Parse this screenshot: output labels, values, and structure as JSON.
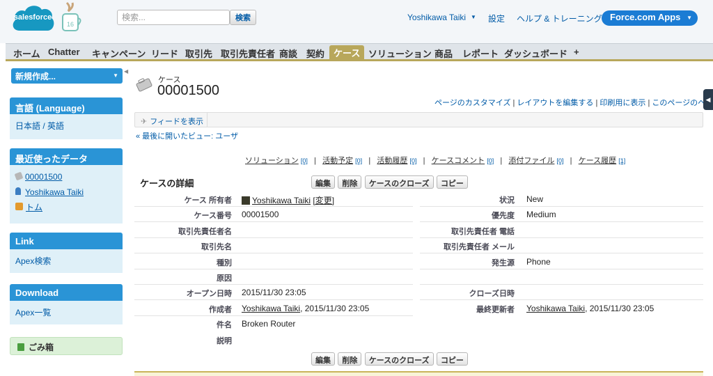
{
  "header": {
    "logo_text": "salesforce",
    "mascot_badge": "16",
    "search_placeholder": "検索...",
    "search_button": "検索",
    "user_name": "Yoshikawa Taiki",
    "setup_link": "設定",
    "help_link": "ヘルプ & トレーニング",
    "app_menu": "Force.com Apps"
  },
  "tabs": [
    {
      "label": "ホーム",
      "active": false
    },
    {
      "label": "Chatter",
      "active": false
    },
    {
      "label": "キャンペーン",
      "active": false
    },
    {
      "label": "リード",
      "active": false
    },
    {
      "label": "取引先",
      "active": false
    },
    {
      "label": "取引先責任者",
      "active": false
    },
    {
      "label": "商談",
      "active": false
    },
    {
      "label": "契約",
      "active": false
    },
    {
      "label": "ケース",
      "active": true
    },
    {
      "label": "ソリューション",
      "active": false
    },
    {
      "label": "商品",
      "active": false
    },
    {
      "label": "レポート",
      "active": false
    },
    {
      "label": "ダッシュボード",
      "active": false
    },
    {
      "label": "+",
      "active": false
    }
  ],
  "sidebar": {
    "new_select": "新規作成...",
    "language": {
      "title": "言語 (Language)",
      "item": "日本語 / 英語"
    },
    "recent": {
      "title": "最近使ったデータ",
      "items": [
        {
          "label": "00001500",
          "icon": "case-icon"
        },
        {
          "label": "Yoshikawa Taiki",
          "icon": "user-icon"
        },
        {
          "label": "トム",
          "icon": "contact-icon"
        }
      ]
    },
    "link": {
      "title": "Link",
      "item": "Apex検索"
    },
    "download": {
      "title": "Download",
      "item": "Apex一覧"
    },
    "trash": "ごみ箱"
  },
  "case": {
    "type_label": "ケース",
    "number": "00001500"
  },
  "page_links": {
    "customize": "ページのカスタマイズ",
    "edit_layout": "レイアウトを編集する",
    "printable": "印刷用に表示",
    "help": "このページのヘルプ"
  },
  "feed_button": "フィードを表示",
  "back_link": "« 最後に開いたビュー: ユーザ",
  "related_links": [
    {
      "label": "ソリューション",
      "count": "[0]"
    },
    {
      "label": "活動予定",
      "count": "[0]"
    },
    {
      "label": "活動履歴",
      "count": "[0]"
    },
    {
      "label": "ケースコメント",
      "count": "[0]"
    },
    {
      "label": "添付ファイル",
      "count": "[0]"
    },
    {
      "label": "ケース履歴",
      "count": "[1]"
    }
  ],
  "detail": {
    "title": "ケースの詳細",
    "buttons": {
      "edit": "編集",
      "delete": "削除",
      "close": "ケースのクローズ",
      "copy": "コピー"
    },
    "owner_label": "ケース 所有者",
    "owner_value": "Yoshikawa Taiki",
    "owner_change": "[変更]",
    "status_label": "状況",
    "status_value": "New",
    "number_label": "ケース番号",
    "number_value": "00001500",
    "priority_label": "優先度",
    "priority_value": "Medium",
    "contact_label": "取引先責任者名",
    "contact_phone_label": "取引先責任者 電話",
    "account_label": "取引先名",
    "contact_email_label": "取引先責任者 メール",
    "type_label": "種別",
    "origin_label": "発生源",
    "origin_value": "Phone",
    "reason_label": "原因",
    "opened_label": "オープン日時",
    "opened_value": "2015/11/30 23:05",
    "closed_label": "クローズ日時",
    "created_by_label": "作成者",
    "created_by_user": "Yoshikawa Taiki",
    "created_by_date": ", 2015/11/30 23:05",
    "modified_by_label": "最終更新者",
    "modified_by_user": "Yoshikawa Taiki",
    "modified_by_date": ", 2015/11/30 23:05",
    "subject_label": "件名",
    "subject_value": "Broken Router",
    "description_label": "説明"
  },
  "colors": {
    "sidebar_header": "#2a94d6",
    "sidebar_body": "#dff0f8",
    "active_tab": "#b8a75b",
    "link": "#015ba7"
  }
}
